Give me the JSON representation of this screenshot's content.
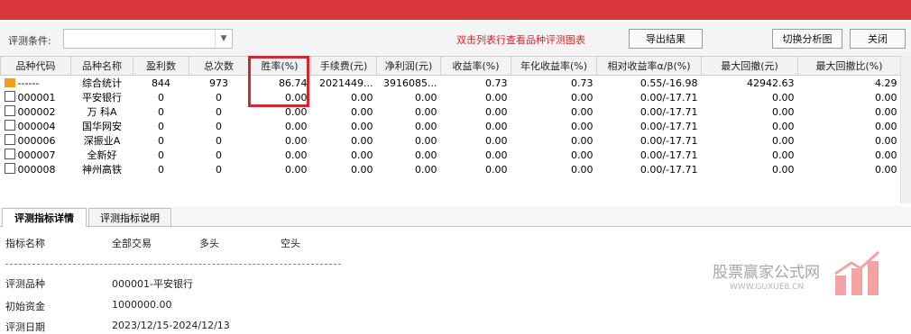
{
  "toolbar": {
    "condition_label": "评测条件:",
    "condition_value": "",
    "hint": "双击列表行查看品种评测图表",
    "export_label": "导出结果",
    "switch_label": "切换分析图",
    "close_label": "关闭"
  },
  "columns": [
    "品种代码",
    "品种名称",
    "盈利数",
    "总次数",
    "胜率(%)",
    "手续费(元)",
    "净利润(元)",
    "收益率(%)",
    "年化收益率(%)",
    "相对收益率α/β(%)",
    "最大回撤(元)",
    "最大回撤比(%)"
  ],
  "summary_row": {
    "code": "------",
    "name": "综合统计",
    "profit_count": "844",
    "total": "973",
    "win_rate": "86.74",
    "fee": "2021449...",
    "net_profit": "3916085...",
    "return": "0.73",
    "annual_return": "0.73",
    "alpha_beta": "0.55/-16.98",
    "max_drawdown": "42942.63",
    "max_drawdown_ratio": "4.29"
  },
  "rows": [
    {
      "code": "000001",
      "name": "平安银行",
      "profit_count": "0",
      "total": "0",
      "win_rate": "0.00",
      "fee": "0.00",
      "net_profit": "0.00",
      "return": "0.00",
      "annual_return": "0.00",
      "alpha_beta": "0.00/-17.71",
      "max_drawdown": "0.00",
      "max_drawdown_ratio": "0.00"
    },
    {
      "code": "000002",
      "name": "万 科A",
      "profit_count": "0",
      "total": "0",
      "win_rate": "0.00",
      "fee": "0.00",
      "net_profit": "0.00",
      "return": "0.00",
      "annual_return": "0.00",
      "alpha_beta": "0.00/-17.71",
      "max_drawdown": "0.00",
      "max_drawdown_ratio": "0.00"
    },
    {
      "code": "000004",
      "name": "国华网安",
      "profit_count": "0",
      "total": "0",
      "win_rate": "0.00",
      "fee": "0.00",
      "net_profit": "0.00",
      "return": "0.00",
      "annual_return": "0.00",
      "alpha_beta": "0.00/-17.71",
      "max_drawdown": "0.00",
      "max_drawdown_ratio": "0.00"
    },
    {
      "code": "000006",
      "name": "深振业A",
      "profit_count": "0",
      "total": "0",
      "win_rate": "0.00",
      "fee": "0.00",
      "net_profit": "0.00",
      "return": "0.00",
      "annual_return": "0.00",
      "alpha_beta": "0.00/-17.71",
      "max_drawdown": "0.00",
      "max_drawdown_ratio": "0.00"
    },
    {
      "code": "000007",
      "name": "全新好",
      "profit_count": "0",
      "total": "0",
      "win_rate": "0.00",
      "fee": "0.00",
      "net_profit": "0.00",
      "return": "0.00",
      "annual_return": "0.00",
      "alpha_beta": "0.00/-17.71",
      "max_drawdown": "0.00",
      "max_drawdown_ratio": "0.00"
    },
    {
      "code": "000008",
      "name": "神州高铁",
      "profit_count": "0",
      "total": "0",
      "win_rate": "0.00",
      "fee": "0.00",
      "net_profit": "0.00",
      "return": "0.00",
      "annual_return": "0.00",
      "alpha_beta": "0.00/-17.71",
      "max_drawdown": "0.00",
      "max_drawdown_ratio": "0.00"
    }
  ],
  "tabs": [
    {
      "label": "评测指标详情",
      "active": true
    },
    {
      "label": "评测指标说明",
      "active": false
    }
  ],
  "detail": {
    "header": {
      "name": "指标名称",
      "all": "全部交易",
      "long": "多头",
      "short": "空头"
    },
    "items": [
      {
        "label": "评测品种",
        "value": "000001-平安银行"
      },
      {
        "label": "初始资金",
        "value": "1000000.00"
      },
      {
        "label": "评测日期",
        "value": "2023/12/15-2024/12/13"
      }
    ]
  },
  "watermark": {
    "text": "股票赢家公式网",
    "url": "WWW.GUXUE8.CN"
  },
  "colors": {
    "title_bar": "#d9363e",
    "highlight": "#cf2a2a",
    "hint": "#d4262b"
  }
}
